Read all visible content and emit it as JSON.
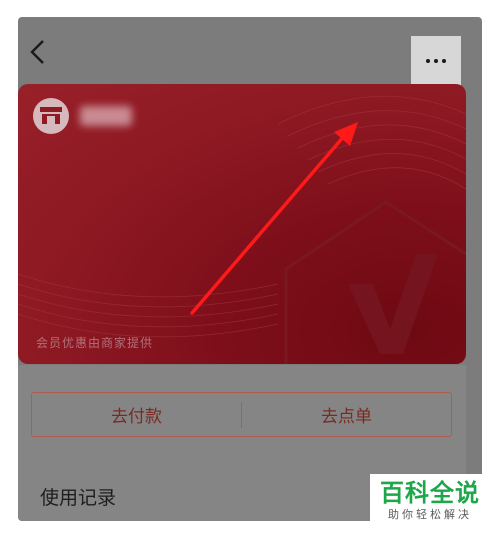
{
  "colors": {
    "overlay": "#7c7c7c",
    "card_red": "#8f1a24",
    "accent": "#7a2a22",
    "annotation_arrow": "#ff1a1a",
    "watermark_green": "#1ea64b"
  },
  "topbar": {
    "back_icon": "chevron-left-icon",
    "more_icon": "more-dots-icon"
  },
  "card": {
    "merchant_name": "商户",
    "footer_text": "会员优惠由商家提供"
  },
  "actions": {
    "pay_label": "去付款",
    "order_label": "去点单"
  },
  "history": {
    "label": "使用记录"
  },
  "watermark": {
    "title": "百科全说",
    "subtitle": "助你轻松解决"
  }
}
